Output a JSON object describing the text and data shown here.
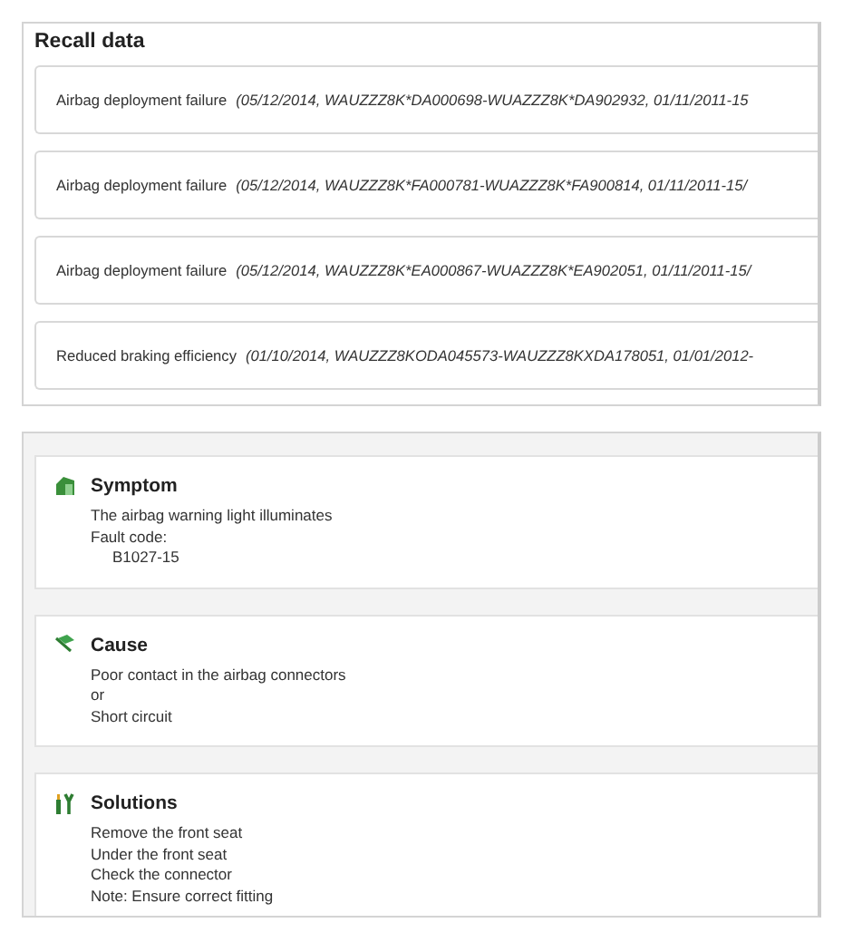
{
  "recall": {
    "title": "Recall data",
    "items": [
      {
        "name": "Airbag deployment failure",
        "details": "(05/12/2014, WAUZZZ8K*DA000698-WUAZZZ8K*DA902932, 01/11/2011-15"
      },
      {
        "name": "Airbag deployment failure",
        "details": "(05/12/2014, WAUZZZ8K*FA000781-WUAZZZ8K*FA900814, 01/11/2011-15/"
      },
      {
        "name": "Airbag deployment failure",
        "details": "(05/12/2014, WAUZZZ8K*EA000867-WUAZZZ8K*EA902051, 01/11/2011-15/"
      },
      {
        "name": "Reduced braking efficiency",
        "details": "(01/10/2014, WAUZZZ8KODA045573-WAUZZZ8KXDA178051, 01/01/2012-"
      }
    ]
  },
  "sections": [
    {
      "kind": "symptom",
      "title": "Symptom",
      "lines": [
        {
          "text": "The airbag warning light illuminates",
          "indent": false
        },
        {
          "text": "Fault code:",
          "indent": false
        },
        {
          "text": "B1027-15",
          "indent": true
        }
      ]
    },
    {
      "kind": "cause",
      "title": "Cause",
      "lines": [
        {
          "text": "Poor contact in the airbag connectors",
          "indent": false
        },
        {
          "text": "or",
          "indent": false
        },
        {
          "text": "Short circuit",
          "indent": false
        }
      ]
    },
    {
      "kind": "solutions",
      "title": "Solutions",
      "lines": [
        {
          "text": "Remove the front seat",
          "indent": false
        },
        {
          "text": "Under the front seat",
          "indent": false
        },
        {
          "text": "Check the connector",
          "indent": false
        },
        {
          "text": "Note: Ensure correct fitting",
          "indent": false
        }
      ]
    }
  ]
}
